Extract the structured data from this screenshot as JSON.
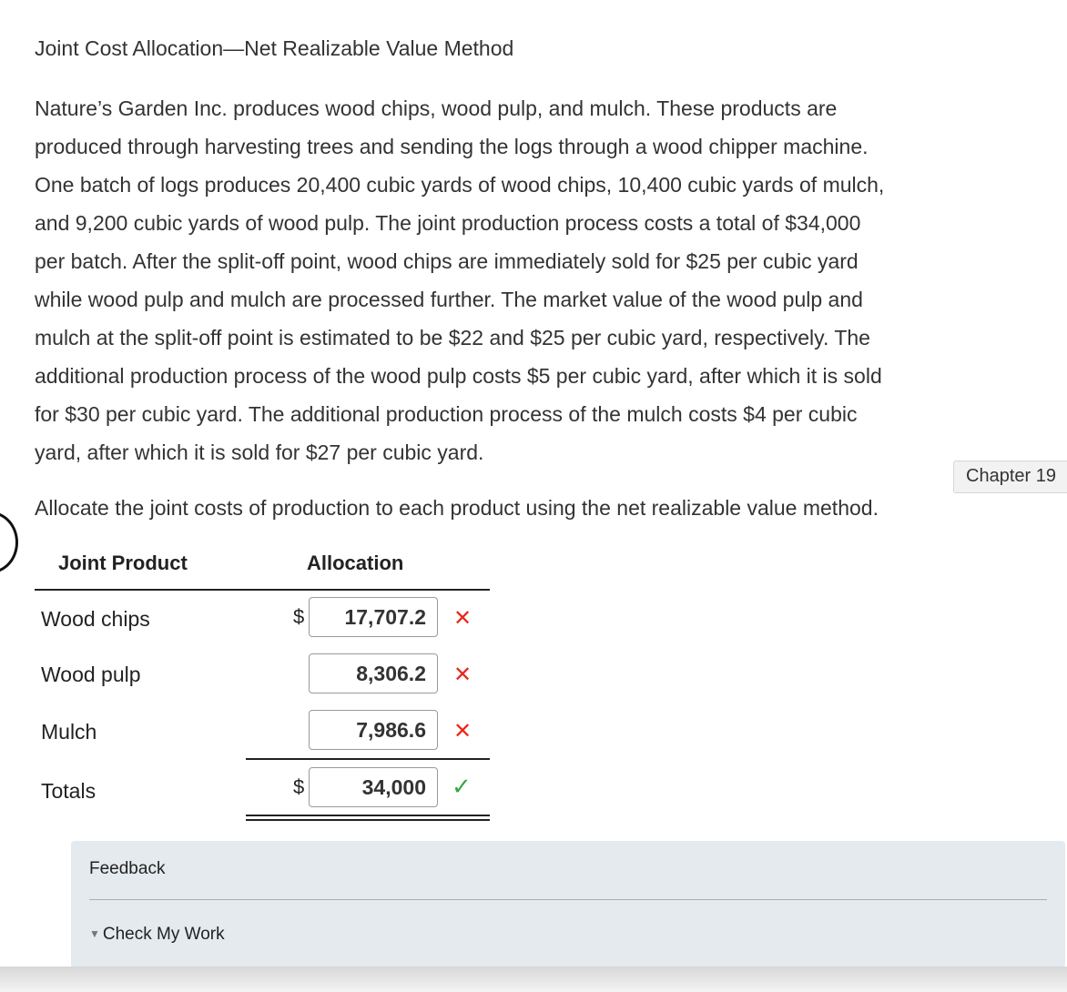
{
  "title": "Joint Cost Allocation—Net Realizable Value Method",
  "problem_lines": [
    "Nature’s Garden Inc. produces wood chips, wood pulp, and mulch. These products are",
    "produced through harvesting trees and sending the logs through a wood chipper machine.",
    "One batch of logs produces 20,400 cubic yards of wood chips, 10,400 cubic yards of mulch,",
    "and 9,200 cubic yards of wood pulp. The joint production process costs a total of $34,000",
    "per batch. After the split-off point, wood chips are immediately sold for $25 per cubic yard",
    "while wood pulp and mulch are processed further. The market value of the wood pulp and",
    "mulch at the split-off point is estimated to be $22 and $25 per cubic yard, respectively. The",
    "additional production process of the wood pulp costs $5 per cubic yard, after which it is sold",
    "for $30 per cubic yard. The additional production process of the mulch costs $4 per cubic",
    "yard, after which it is sold for $27 per cubic yard."
  ],
  "chapter_tab": "Chapter 19",
  "instruction": "Allocate the joint costs of production to each product using the net realizable value method.",
  "table": {
    "headers": {
      "product": "Joint Product",
      "allocation": "Allocation"
    },
    "currency_symbol": "$",
    "rows": [
      {
        "label": "Wood chips",
        "value": "17,707.2",
        "status": "incorrect"
      },
      {
        "label": "Wood pulp",
        "value": "8,306.2",
        "status": "incorrect"
      },
      {
        "label": "Mulch",
        "value": "7,986.6",
        "status": "incorrect"
      }
    ],
    "totals": {
      "label": "Totals",
      "value": "34,000",
      "status": "correct"
    },
    "marks": {
      "incorrect": "✕",
      "correct": "✓"
    },
    "colors": {
      "incorrect": "#e8291c",
      "correct": "#39a845"
    }
  },
  "feedback": {
    "label": "Feedback",
    "check_my_work": "Check My Work"
  }
}
